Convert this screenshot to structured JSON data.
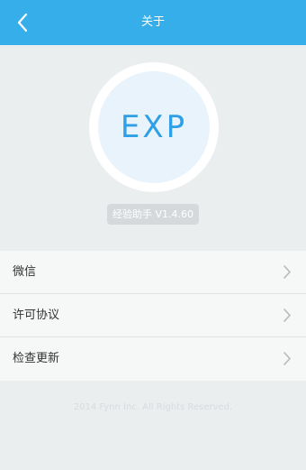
{
  "header": {
    "title": "关于",
    "back_icon": "chevron-left-icon"
  },
  "logo": {
    "text": "EXP"
  },
  "version": {
    "label": "经验助手 V1.4.60"
  },
  "menu": {
    "items": [
      {
        "label": "微信",
        "icon": "chevron-right-icon"
      },
      {
        "label": "许可协议",
        "icon": "chevron-right-icon"
      },
      {
        "label": "检查更新",
        "icon": "chevron-right-icon"
      }
    ]
  },
  "footer": {
    "copyright": "2014 Fynn Inc. All Rights Reserved."
  },
  "colors": {
    "header": "#35aee9",
    "accent": "#2f9fe6",
    "background": "#ebeeef"
  }
}
